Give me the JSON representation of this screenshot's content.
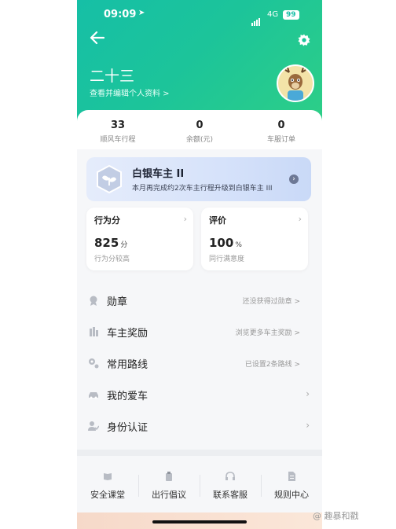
{
  "status_bar": {
    "time": "09:09",
    "location_glyph": "➤",
    "network": "4G",
    "battery": "99"
  },
  "header": {
    "name": "二十三",
    "edit_profile": "查看并编辑个人资料 >"
  },
  "stats": [
    {
      "value": "33",
      "label": "顺风车行程"
    },
    {
      "value": "0",
      "label": "余额(元)"
    },
    {
      "value": "0",
      "label": "车服订单"
    }
  ],
  "silver": {
    "title": "白银车主 II",
    "desc": "本月再完成约2次车主行程升级到白银车主 III",
    "arrow": "›"
  },
  "cards": {
    "behavior": {
      "title": "行为分",
      "value": "825",
      "unit": "分",
      "sub": "行为分较高",
      "arrow": "›"
    },
    "rating": {
      "title": "评价",
      "value": "100",
      "unit": "%",
      "sub": "同行满意度",
      "arrow": "›"
    }
  },
  "menu": [
    {
      "label": "勋章",
      "hint": "还没获得过勋章 >",
      "icon": "medal-icon"
    },
    {
      "label": "车主奖励",
      "hint": "浏览更多车主奖励 >",
      "icon": "gift-icon"
    },
    {
      "label": "常用路线",
      "hint": "已设置2条路线 >",
      "icon": "route-icon"
    },
    {
      "label": "我的爱车",
      "hint": "",
      "icon": "car-icon"
    },
    {
      "label": "身份认证",
      "hint": "",
      "icon": "id-icon"
    }
  ],
  "menu_chevron": "›",
  "bottom": [
    {
      "label": "安全课堂",
      "icon": "book-icon"
    },
    {
      "label": "出行倡议",
      "icon": "clipboard-icon"
    },
    {
      "label": "联系客服",
      "icon": "headset-icon"
    },
    {
      "label": "规则中心",
      "icon": "document-icon"
    }
  ],
  "watermark": "@ 趣暴和戳",
  "colors": {
    "accent": "#1cc49a",
    "silver_bg": "#d6e2fa"
  }
}
